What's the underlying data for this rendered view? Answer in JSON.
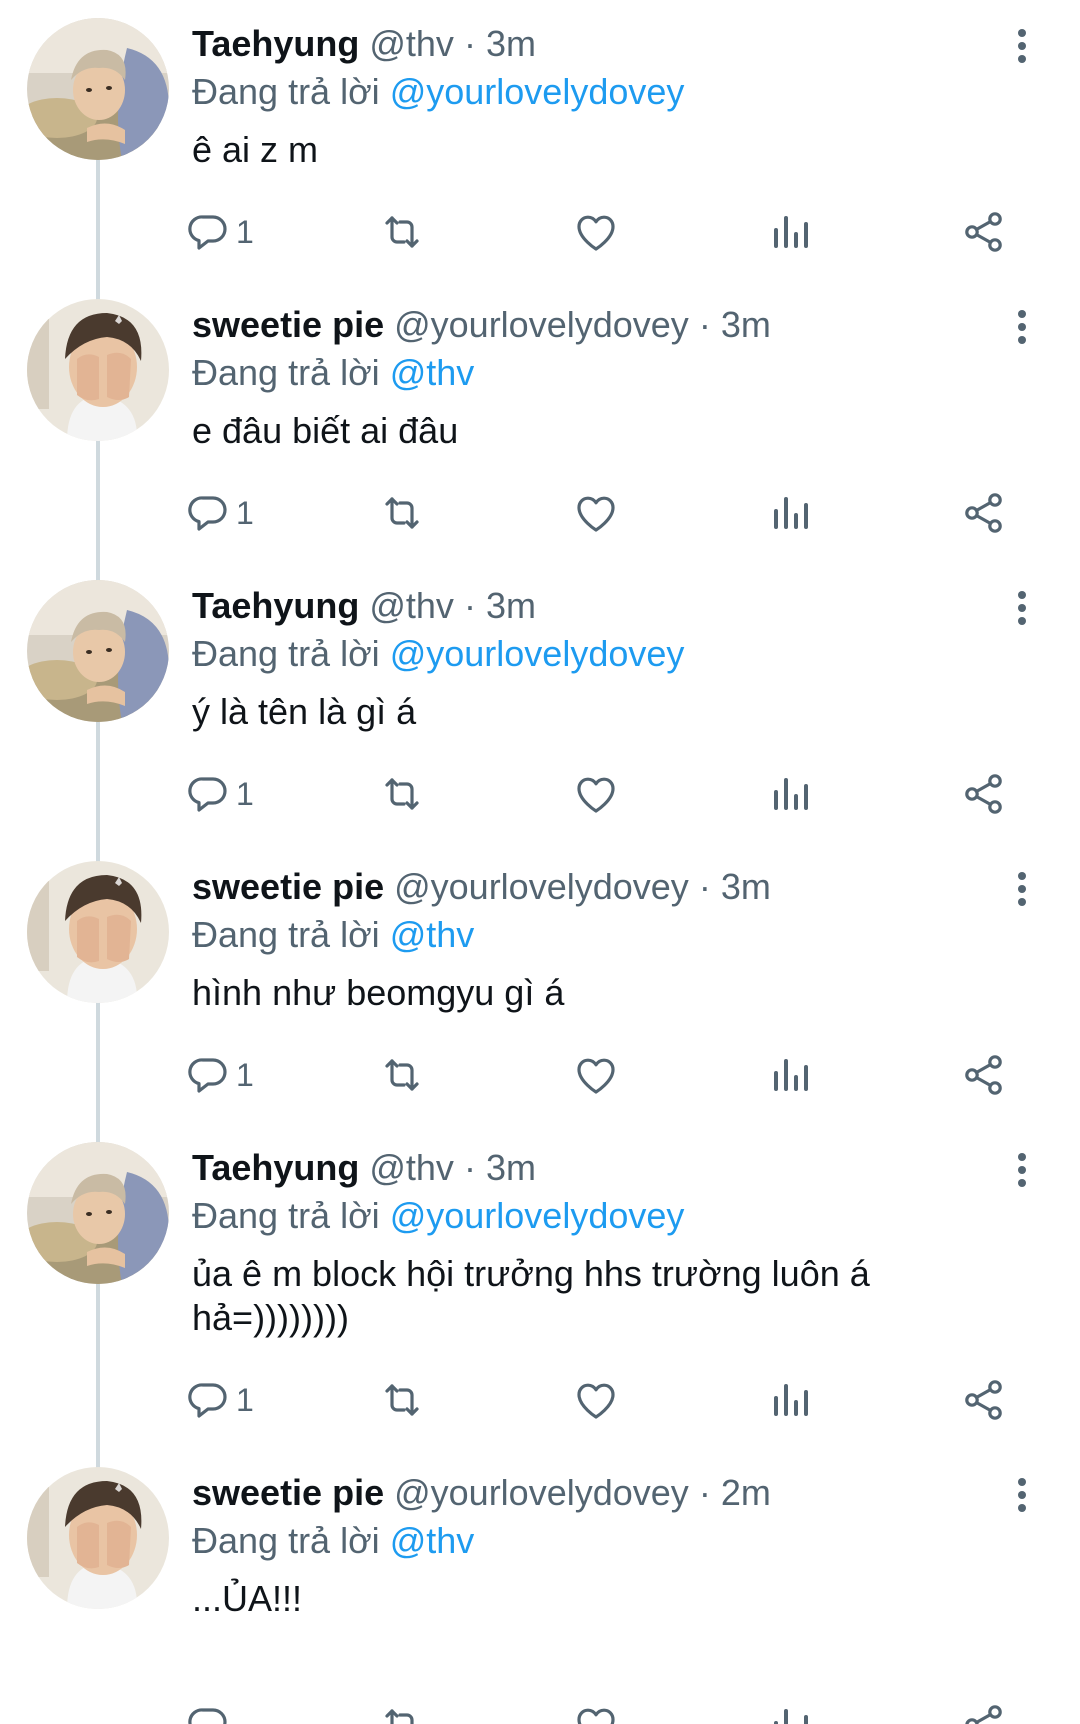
{
  "colors": {
    "text": "#0f1419",
    "secondary": "#536471",
    "link": "#1d9bf0",
    "thread_line": "#cfd9de"
  },
  "tweets": [
    {
      "name": "Taehyung",
      "handle": "@thv",
      "dot": "·",
      "time": "3m",
      "replying_prefix": "Đang trả lời",
      "replying_to": "@yourlovelydovey",
      "text": "ê ai z m",
      "reply_count": "1",
      "avatar": "taehyung-avatar"
    },
    {
      "name": "sweetie pie",
      "handle": "@yourlovelydovey",
      "dot": "·",
      "time": "3m",
      "replying_prefix": "Đang trả lời",
      "replying_to": "@thv",
      "text": "e đâu biết ai đâu",
      "reply_count": "1",
      "avatar": "sweetie-pie-avatar"
    },
    {
      "name": "Taehyung",
      "handle": "@thv",
      "dot": "·",
      "time": "3m",
      "replying_prefix": "Đang trả lời",
      "replying_to": "@yourlovelydovey",
      "text": "ý là tên là gì á",
      "reply_count": "1",
      "avatar": "taehyung-avatar"
    },
    {
      "name": "sweetie pie",
      "handle": "@yourlovelydovey",
      "dot": "·",
      "time": "3m",
      "replying_prefix": "Đang trả lời",
      "replying_to": "@thv",
      "text": "hình như beomgyu gì á",
      "reply_count": "1",
      "avatar": "sweetie-pie-avatar"
    },
    {
      "name": "Taehyung",
      "handle": "@thv",
      "dot": "·",
      "time": "3m",
      "replying_prefix": "Đang trả lời",
      "replying_to": "@yourlovelydovey",
      "text": "ủa ê m block hội trưởng hhs trường luôn á hả=))))))))",
      "reply_count": "1",
      "avatar": "taehyung-avatar"
    },
    {
      "name": "sweetie pie",
      "handle": "@yourlovelydovey",
      "dot": "·",
      "time": "2m",
      "replying_prefix": "Đang trả lời",
      "replying_to": "@thv",
      "text": "...ỦA!!!",
      "reply_count": "",
      "avatar": "sweetie-pie-avatar"
    }
  ]
}
